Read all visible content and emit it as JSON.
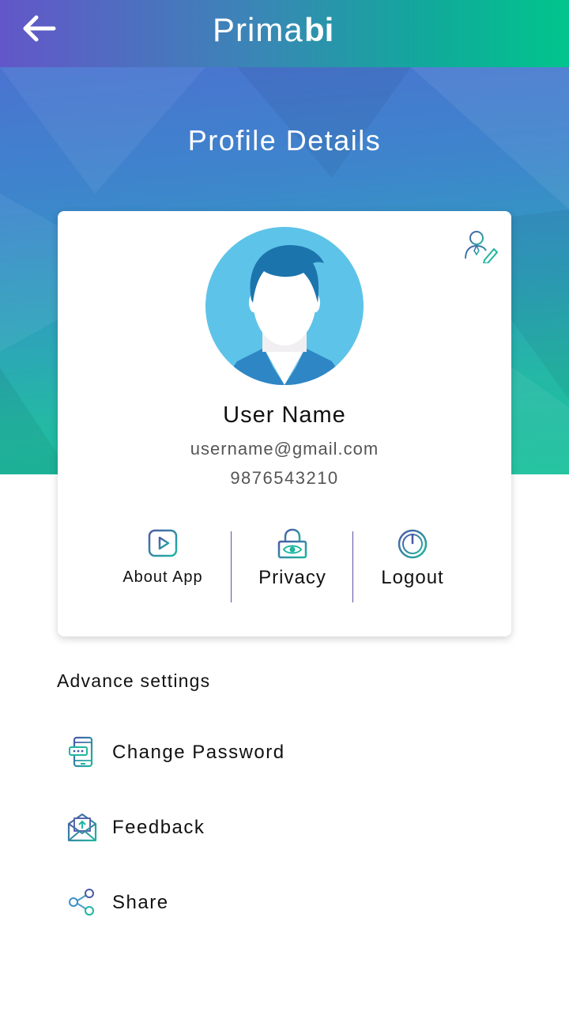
{
  "app": {
    "logo_text": "Prima",
    "logo_suffix": "bi"
  },
  "header": {
    "back_icon": "arrow-left-icon"
  },
  "hero": {
    "title": "Profile Details"
  },
  "profile": {
    "name": "User Name",
    "email": "username@gmail.com",
    "phone": "9876543210",
    "edit_icon": "edit-user-icon"
  },
  "actions": [
    {
      "label": "About App",
      "icon": "play-square-icon"
    },
    {
      "label": "Privacy",
      "icon": "lock-eye-icon"
    },
    {
      "label": "Logout",
      "icon": "power-icon"
    }
  ],
  "settings": {
    "title": "Advance settings",
    "items": [
      {
        "label": "Change Password",
        "icon": "phone-password-icon"
      },
      {
        "label": "Feedback",
        "icon": "envelope-upload-icon"
      },
      {
        "label": "Share",
        "icon": "share-icon"
      }
    ]
  },
  "colors": {
    "gradient_start": "#6356c9",
    "gradient_end": "#01c58c",
    "icon_accent": "#1fb6a0",
    "icon_secondary": "#4a5aa8",
    "avatar_bg": "#5ec3e8"
  }
}
